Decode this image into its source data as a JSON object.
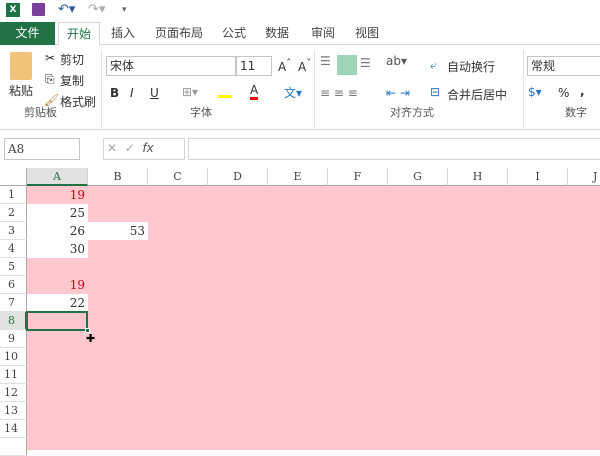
{
  "qat": {
    "app_icon": "X"
  },
  "tabs": [
    "文件",
    "开始",
    "插入",
    "页面布局",
    "公式",
    "数据",
    "审阅",
    "视图"
  ],
  "clipboard": {
    "paste": "粘贴",
    "cut": "剪切",
    "copy": "复制",
    "format_painter": "格式刷",
    "group": "剪贴板"
  },
  "font": {
    "name": "宋体",
    "size": "11",
    "bold": "B",
    "italic": "I",
    "underline": "U",
    "font_color": "A",
    "group": "字体"
  },
  "alignment": {
    "wrap": "自动换行",
    "merge": "合并后居中",
    "group": "对齐方式"
  },
  "number": {
    "format": "常规",
    "percent": "%",
    "comma": ",",
    "group": "数字"
  },
  "formula_bar": {
    "name_box": "A8",
    "fx": "fx",
    "value": ""
  },
  "columns": [
    "A",
    "B",
    "C",
    "D",
    "E",
    "F",
    "G",
    "H",
    "I",
    "J"
  ],
  "rows": [
    "1",
    "2",
    "3",
    "4",
    "5",
    "6",
    "7",
    "8",
    "9",
    "10",
    "11",
    "12",
    "13",
    "14"
  ],
  "cells": {
    "A1": "19",
    "A2": "25",
    "A3": "26",
    "B3": "53",
    "A4": "30",
    "A6": "19",
    "A7": "22"
  },
  "colors": {
    "highlight": "#ffc7ce",
    "red_text": "#c00000",
    "accent": "#217346"
  }
}
